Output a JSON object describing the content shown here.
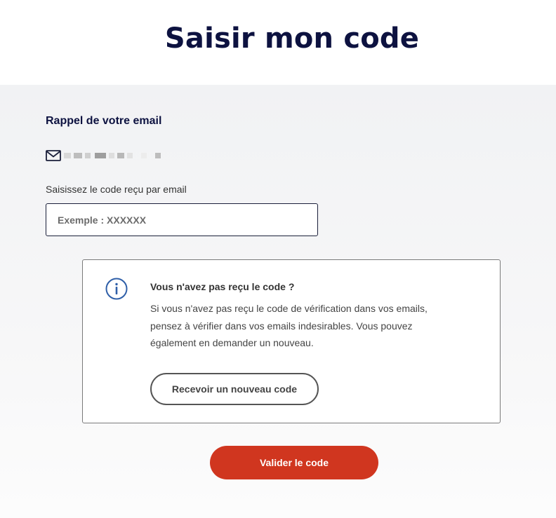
{
  "header": {
    "title": "Saisir mon code"
  },
  "reminder": {
    "label": "Rappel de votre email",
    "icon": "mail-icon"
  },
  "code_field": {
    "label": "Saisissez le code reçu par email",
    "placeholder": "Exemple : XXXXXX",
    "value": ""
  },
  "info": {
    "icon": "info-icon",
    "title": "Vous n'avez pas reçu le code ?",
    "text": "Si vous n'avez pas reçu le code de vérification dans vos emails, pensez à vérifier dans vos emails indesirables. Vous pouvez également en demander un nouveau.",
    "resend_label": "Recevoir un nouveau code"
  },
  "submit": {
    "label": "Valider le code"
  },
  "colors": {
    "title": "#0d1240",
    "primary_button": "#d0361f",
    "info_icon": "#2f5fa8"
  }
}
